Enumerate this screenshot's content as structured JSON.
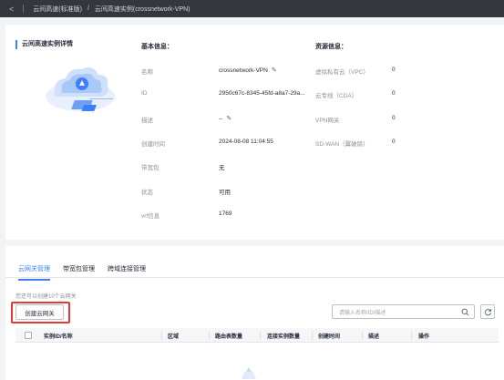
{
  "breadcrumb": {
    "back": "<",
    "parent": "云间高速(标准版)",
    "separator": "/",
    "current": "云间高速实例(crossnetwork-VPN)"
  },
  "detail": {
    "title": "云间高速实例详情"
  },
  "basic": {
    "title": "基本信息：",
    "rows": [
      {
        "label": "名称",
        "value": "crossnetwork-VPN",
        "editable": true
      },
      {
        "label": "ID",
        "value": "2950c67c-8345-45fd-a8a7-29a...",
        "editable": false
      },
      {
        "label": "描述",
        "value": "--",
        "editable": true
      },
      {
        "label": "创建时间",
        "value": "2024-08-08 11:04:55",
        "editable": false
      },
      {
        "label": "带宽包",
        "value": "无",
        "editable": false
      },
      {
        "label": "状态",
        "value": "可用",
        "editable": false
      },
      {
        "label": "vrf信息",
        "value": "1769",
        "editable": false
      }
    ]
  },
  "resources": {
    "title": "资源信息：",
    "rows": [
      {
        "label": "虚拟私有云（VPC）",
        "value": "0"
      },
      {
        "label": "云专线（CDA）",
        "value": "0"
      },
      {
        "label": "VPN网关",
        "value": "0"
      },
      {
        "label": "SD-WAN（翼破除）",
        "value": "0"
      }
    ]
  },
  "tabs": [
    {
      "label": "云网关管理",
      "active": true
    },
    {
      "label": "带宽包管理",
      "active": false
    },
    {
      "label": "跨域连接管理",
      "active": false
    }
  ],
  "gateway": {
    "quota_text": "您还可以创建10个云网关",
    "create_label": "创建云网关",
    "search_placeholder": "请输入名称/ID/描述"
  },
  "table": {
    "columns": [
      "实例ID/名称",
      "区域",
      "路由表数量",
      "连接实例数量",
      "创建时间",
      "描述",
      "操作"
    ]
  },
  "colors": {
    "accent": "#3d7ffc",
    "highlight": "#e53935",
    "topbar": "#34373c"
  }
}
